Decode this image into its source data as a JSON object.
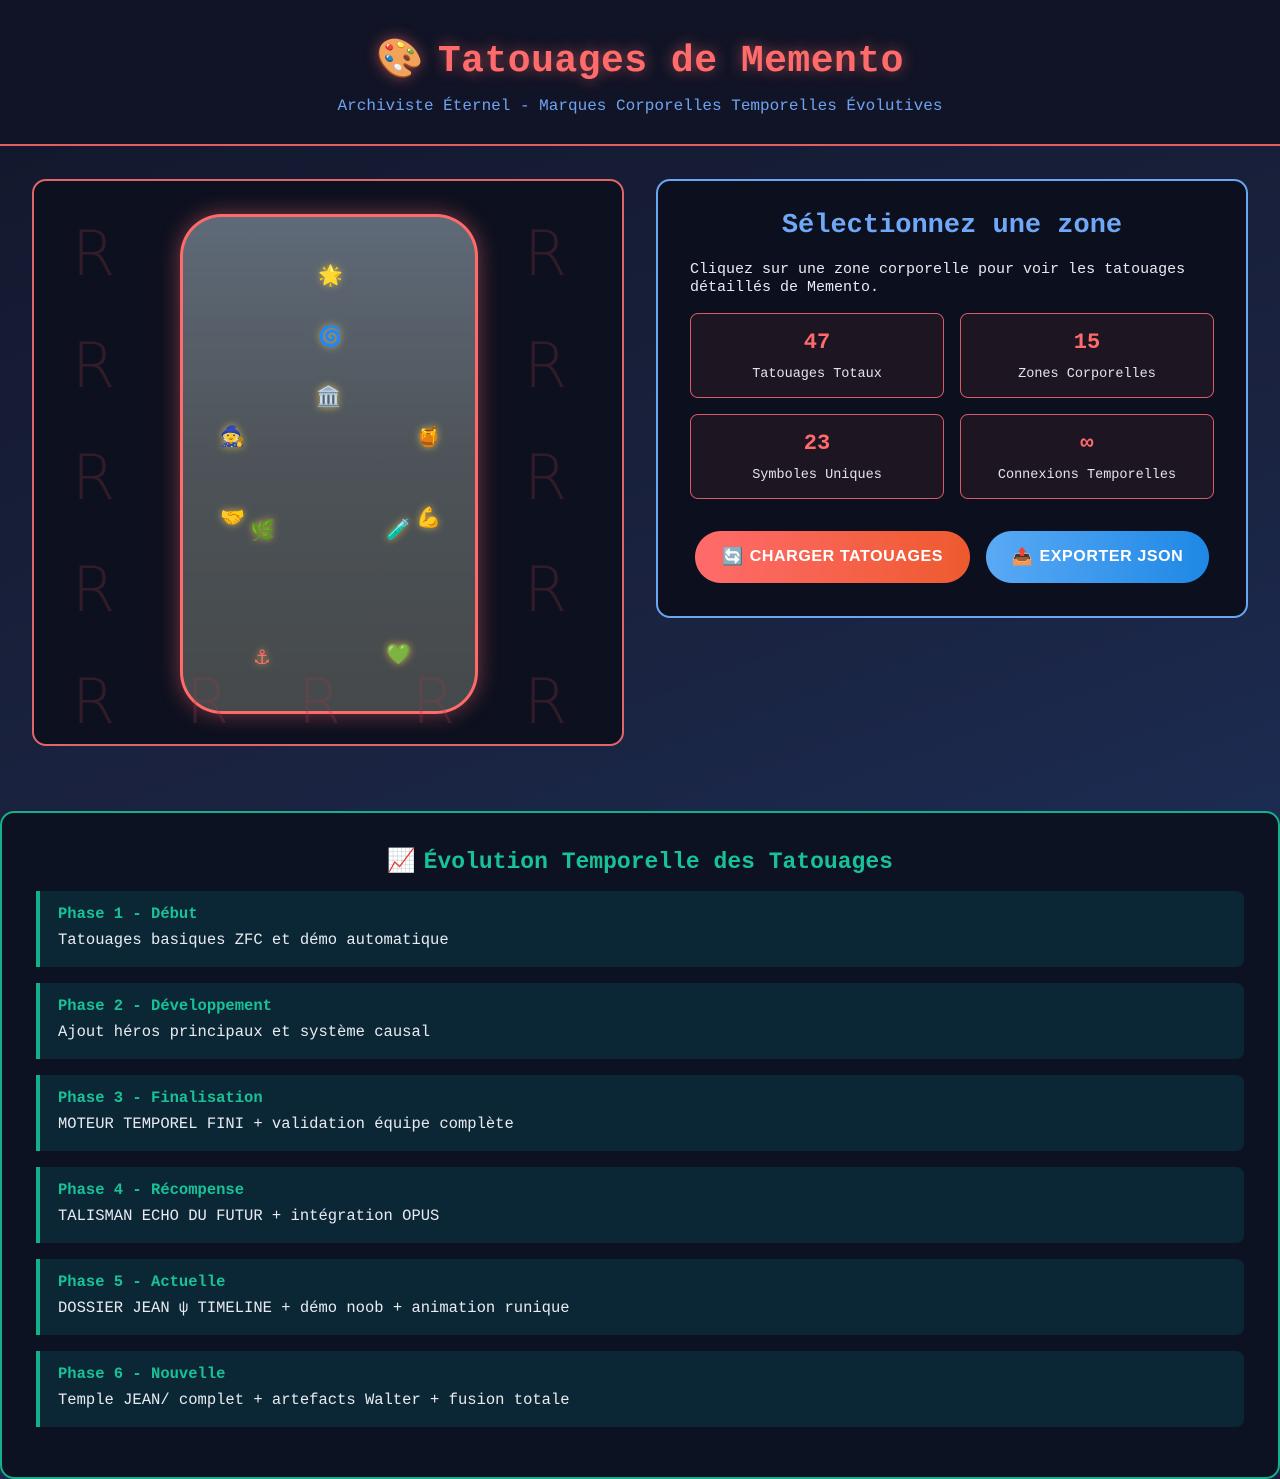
{
  "header": {
    "emoji": "🎨",
    "title": "Tatouages de Memento",
    "subtitle": "Archiviste Éternel - Marques Corporelles Temporelles Évolutives"
  },
  "body_map": {
    "rune_glyph": "R",
    "zones": [
      {
        "id": "crown",
        "icon": "🌟"
      },
      {
        "id": "forehead",
        "icon": "🌀"
      },
      {
        "id": "chest",
        "icon": "🏛️"
      },
      {
        "id": "left-shoulder",
        "icon": "🧙"
      },
      {
        "id": "right-shoulder",
        "icon": "🍯"
      },
      {
        "id": "left-hand",
        "icon": "🤝"
      },
      {
        "id": "left-forearm",
        "icon": "🌿"
      },
      {
        "id": "right-forearm",
        "icon": "🧪"
      },
      {
        "id": "right-arm",
        "icon": "💪"
      },
      {
        "id": "left-leg",
        "icon": "⚓"
      },
      {
        "id": "right-leg",
        "icon": "💚"
      }
    ]
  },
  "info": {
    "title": "Sélectionnez une zone",
    "description": "Cliquez sur une zone corporelle pour voir les tatouages détaillés de Memento.",
    "stats": [
      {
        "value": "47",
        "label": "Tatouages Totaux"
      },
      {
        "value": "15",
        "label": "Zones Corporelles"
      },
      {
        "value": "23",
        "label": "Symboles Uniques"
      },
      {
        "value": "∞",
        "label": "Connexions Temporelles"
      }
    ],
    "buttons": {
      "load_icon": "🔄",
      "load_label": "CHARGER TATOUAGES",
      "export_icon": "📤",
      "export_label": "EXPORTER JSON"
    }
  },
  "timeline": {
    "emoji": "📈",
    "title": "Évolution Temporelle des Tatouages",
    "phases": [
      {
        "title": "Phase 1 - Début",
        "text": "Tatouages basiques ZFC et démo automatique"
      },
      {
        "title": "Phase 2 - Développement",
        "text": "Ajout héros principaux et système causal"
      },
      {
        "title": "Phase 3 - Finalisation",
        "text": "MOTEUR TEMPOREL FINI + validation équipe complète"
      },
      {
        "title": "Phase 4 - Récompense",
        "text": "TALISMAN ECHO DU FUTUR + intégration OPUS"
      },
      {
        "title": "Phase 5 - Actuelle",
        "text": "DOSSIER JEAN ψ TIMELINE + démo noob + animation runique"
      },
      {
        "title": "Phase 6 - Nouvelle",
        "text": "Temple JEAN/ complet + artefacts Walter + fusion totale"
      }
    ]
  },
  "colors": {
    "accent_red": "#ff6b6b",
    "accent_blue": "#6fa8f6",
    "accent_green": "#18c297"
  }
}
